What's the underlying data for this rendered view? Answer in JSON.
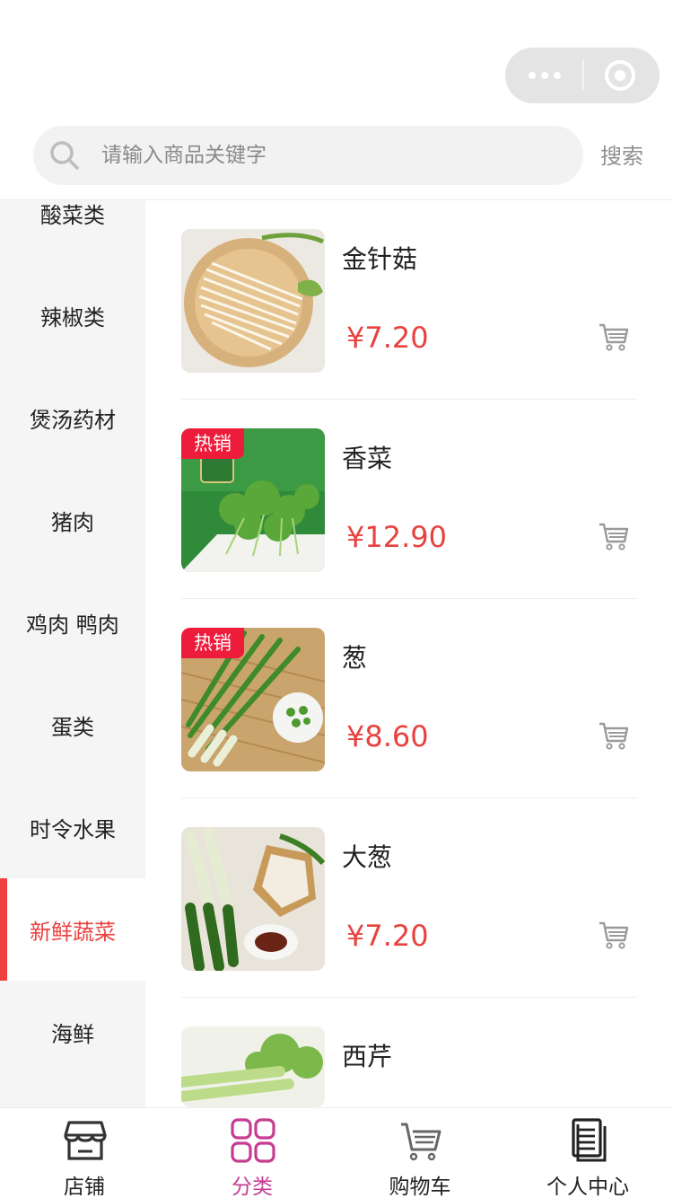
{
  "capsule": {
    "more_icon": "more-dots-icon",
    "close_icon": "target-circle-icon"
  },
  "search": {
    "placeholder": "请输入商品关键字",
    "value": "",
    "button_label": "搜索",
    "icon": "search-icon"
  },
  "sidebar": {
    "items": [
      {
        "label": "酸菜类"
      },
      {
        "label": "辣椒类"
      },
      {
        "label": "煲汤药材"
      },
      {
        "label": "猪肉"
      },
      {
        "label": "鸡肉 鸭肉"
      },
      {
        "label": "蛋类"
      },
      {
        "label": "时令水果"
      },
      {
        "label": "新鲜蔬菜"
      },
      {
        "label": "海鲜"
      }
    ],
    "active_label": "新鲜蔬菜",
    "active_color": "#e8423f"
  },
  "products": [
    {
      "name": "金针菇",
      "price": "¥7.20",
      "badge": ""
    },
    {
      "name": "香菜",
      "price": "¥12.90",
      "badge": "热销"
    },
    {
      "name": "葱",
      "price": "¥8.60",
      "badge": "热销"
    },
    {
      "name": "大葱",
      "price": "¥7.20",
      "badge": ""
    },
    {
      "name": "西芹",
      "price": "",
      "badge": ""
    }
  ],
  "tabbar": {
    "tabs": [
      {
        "label": "店铺",
        "icon": "store-icon"
      },
      {
        "label": "分类",
        "icon": "category-grid-icon"
      },
      {
        "label": "购物车",
        "icon": "shopping-cart-icon"
      },
      {
        "label": "个人中心",
        "icon": "document-user-icon"
      }
    ],
    "active_label": "分类",
    "active_color": "#c53c92"
  },
  "colors": {
    "price": "#e8423f",
    "badge": "#ee1c3b",
    "sidebar_bg": "#f5f5f5"
  }
}
